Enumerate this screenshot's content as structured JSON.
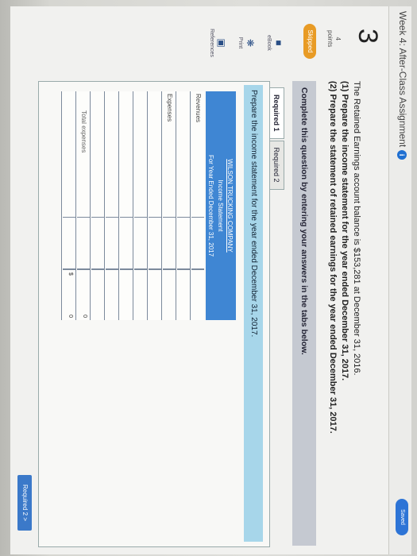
{
  "header": {
    "title": "Week 4: After-Class Assignment",
    "info_icon": "i",
    "saved_label": "Saved"
  },
  "question": {
    "number": "3",
    "points_value": "4",
    "points_label": "points",
    "status": "Skipped",
    "intro_line1": "The Retained Earnings account balance is $153,281 at December 31, 2016.",
    "intro_line2": "(1) Prepare the income statement for the year ended December 31, 2017.",
    "intro_line3": "(2) Prepare the statement of retained earnings for the year ended December 31, 2017."
  },
  "sidebar": {
    "items": [
      {
        "label": "eBook",
        "icon": "book-icon"
      },
      {
        "label": "Print",
        "icon": "print-icon"
      },
      {
        "label": "References",
        "icon": "references-icon"
      }
    ]
  },
  "instructions": "Complete this question by entering your answers in the tabs below.",
  "tabs": [
    {
      "label": "Required 1"
    },
    {
      "label": "Required 2"
    }
  ],
  "panel": {
    "prompt": "Prepare the income statement for the year ended December 31, 2017.",
    "company": "WILSON TRUCKING COMPANY",
    "statement": "Income Statement",
    "period": "For Year Ended December 31, 2017"
  },
  "table": {
    "revenues_label": "Revenues",
    "expenses_label": "Expenses",
    "total_expenses_label": "Total expenses",
    "total_expenses_value": "0",
    "currency": "$",
    "final_value": "0"
  },
  "next_button": "Required 2  >"
}
